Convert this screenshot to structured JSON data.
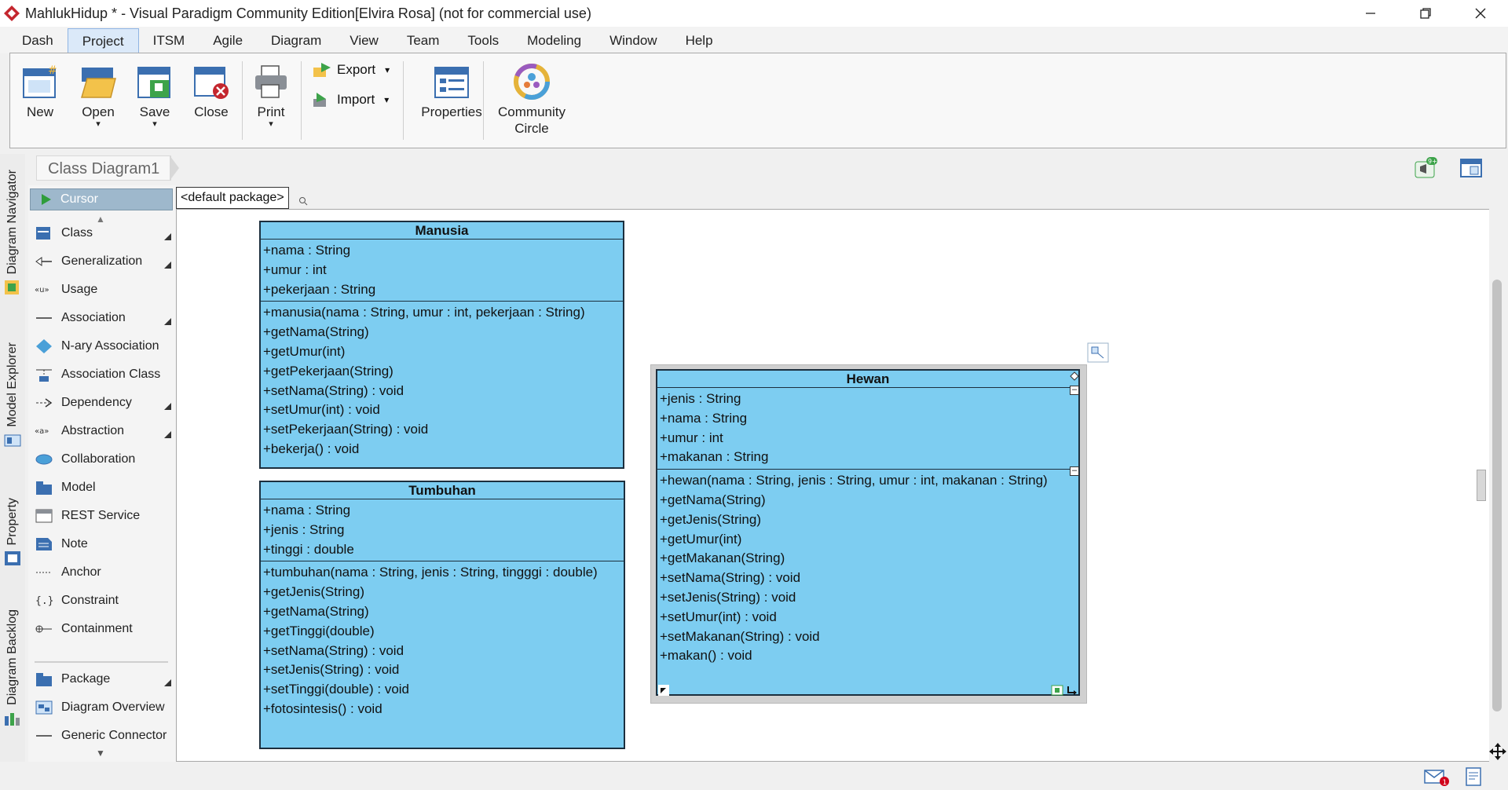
{
  "window": {
    "title": "MahlukHidup * - Visual Paradigm Community Edition[Elvira Rosa] (not for commercial use)"
  },
  "menubar": {
    "items": [
      "Dash",
      "Project",
      "ITSM",
      "Agile",
      "Diagram",
      "View",
      "Team",
      "Tools",
      "Modeling",
      "Window",
      "Help"
    ],
    "active": "Project"
  },
  "ribbon": {
    "new_label": "New",
    "open_label": "Open",
    "save_label": "Save",
    "close_label": "Close",
    "print_label": "Print",
    "export_label": "Export",
    "import_label": "Import",
    "properties_label": "Properties",
    "community_label_1": "Community",
    "community_label_2": "Circle"
  },
  "side_tabs": {
    "diagram_navigator": "Diagram Navigator",
    "model_explorer": "Model Explorer",
    "property": "Property",
    "diagram_backlog": "Diagram Backlog"
  },
  "diagram": {
    "breadcrumb": "Class Diagram1",
    "package_tab": "<default package>",
    "notification_badge": "9+"
  },
  "palette": {
    "cursor": "Cursor",
    "items": [
      {
        "label": "Class",
        "icon": "class-icon",
        "submenu": true
      },
      {
        "label": "Generalization",
        "icon": "generalization-icon",
        "submenu": true
      },
      {
        "label": "Usage",
        "icon": "usage-icon",
        "submenu": false
      },
      {
        "label": "Association",
        "icon": "association-icon",
        "submenu": true
      },
      {
        "label": "N-ary Association",
        "icon": "nary-association-icon",
        "submenu": false
      },
      {
        "label": "Association Class",
        "icon": "association-class-icon",
        "submenu": false
      },
      {
        "label": "Dependency",
        "icon": "dependency-icon",
        "submenu": true
      },
      {
        "label": "Abstraction",
        "icon": "abstraction-icon",
        "submenu": true
      },
      {
        "label": "Collaboration",
        "icon": "collaboration-icon",
        "submenu": false
      },
      {
        "label": "Model",
        "icon": "model-icon",
        "submenu": false
      },
      {
        "label": "REST Service",
        "icon": "rest-service-icon",
        "submenu": false
      },
      {
        "label": "Note",
        "icon": "note-icon",
        "submenu": false
      },
      {
        "label": "Anchor",
        "icon": "anchor-icon",
        "submenu": false
      },
      {
        "label": "Constraint",
        "icon": "constraint-icon",
        "submenu": false
      },
      {
        "label": "Containment",
        "icon": "containment-icon",
        "submenu": false
      },
      {
        "label": "Package",
        "icon": "package-icon",
        "submenu": true
      },
      {
        "label": "Diagram Overview",
        "icon": "diagram-overview-icon",
        "submenu": false
      },
      {
        "label": "Generic Connector",
        "icon": "generic-connector-icon",
        "submenu": false
      }
    ]
  },
  "classes": {
    "manusia": {
      "name": "Manusia",
      "attributes": [
        "+nama : String",
        "+umur : int",
        "+pekerjaan : String"
      ],
      "operations": [
        "+manusia(nama : String, umur : int, pekerjaan : String)",
        "+getNama(String)",
        "+getUmur(int)",
        "+getPekerjaan(String)",
        "+setNama(String) : void",
        "+setUmur(int) : void",
        "+setPekerjaan(String) : void",
        "+bekerja() : void"
      ]
    },
    "tumbuhan": {
      "name": "Tumbuhan",
      "attributes": [
        "+nama : String",
        "+jenis : String",
        "+tinggi : double"
      ],
      "operations": [
        "+tumbuhan(nama : String, jenis : String, tingggi : double)",
        "+getJenis(String)",
        "+getNama(String)",
        "+getTinggi(double)",
        "+setNama(String) : void",
        "+setJenis(String) : void",
        "+setTinggi(double) : void",
        "+fotosintesis() : void"
      ]
    },
    "hewan": {
      "name": "Hewan",
      "attributes": [
        "+jenis : String",
        "+nama : String",
        "+umur : int",
        "+makanan : String"
      ],
      "operations": [
        "+hewan(nama : String, jenis : String, umur : int, makanan : String)",
        "+getNama(String)",
        "+getJenis(String)",
        "+getUmur(int)",
        "+getMakanan(String)",
        "+setNama(String) : void",
        "+setJenis(String) : void",
        "+setUmur(int) : void",
        "+setMakanan(String) : void",
        "+makan() : void"
      ]
    }
  },
  "statusbar": {
    "mail_count": "1"
  },
  "colors": {
    "class_fill": "#7dcdf1",
    "class_border": "#1c2f3e",
    "menu_active": "#dbe9f9"
  }
}
